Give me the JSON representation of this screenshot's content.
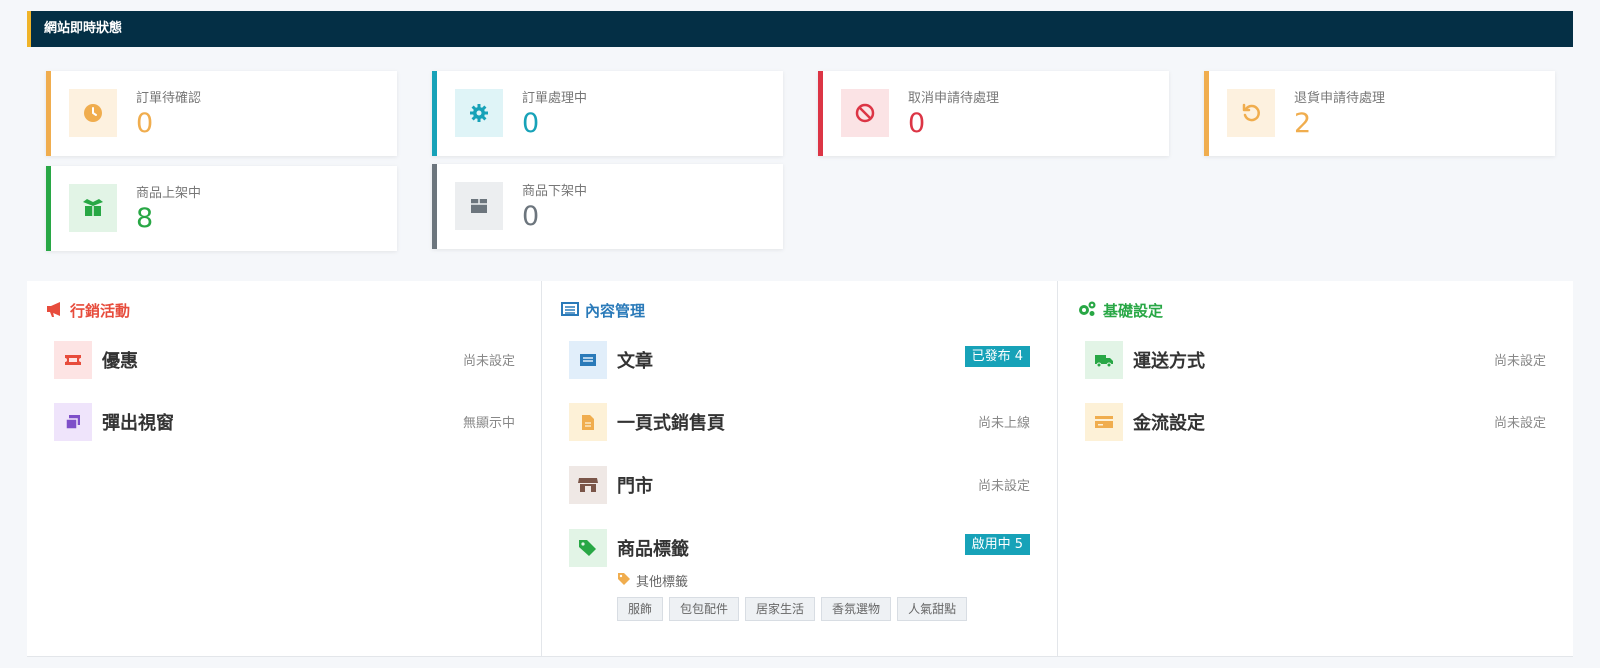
{
  "header": {
    "title": "網站即時狀態"
  },
  "stats": {
    "pending_confirm": {
      "label": "訂單待確認",
      "value": "0",
      "color": "#f0ad4e",
      "icon": "clock-icon"
    },
    "processing": {
      "label": "訂單處理中",
      "value": "0",
      "color": "#17a2b8",
      "icon": "gear-icon"
    },
    "cancel_pending": {
      "label": "取消申請待處理",
      "value": "0",
      "color": "#dc3545",
      "icon": "ban-icon"
    },
    "return_pending": {
      "label": "退貨申請待處理",
      "value": "2",
      "color": "#f0ad4e",
      "icon": "undo-icon"
    },
    "listed": {
      "label": "商品上架中",
      "value": "8",
      "color": "#28a745",
      "icon": "box-open-icon"
    },
    "unlisted": {
      "label": "商品下架中",
      "value": "0",
      "color": "#6c757d",
      "icon": "box-icon"
    }
  },
  "marketing": {
    "title": "行銷活動",
    "color": "#e74c3c",
    "items": [
      {
        "label": "優惠",
        "status": "尚未設定",
        "icon": "ticket-icon"
      },
      {
        "label": "彈出視窗",
        "status": "無顯示中",
        "icon": "window-icon"
      }
    ]
  },
  "content": {
    "title": "內容管理",
    "color": "#2a7ab9",
    "items": [
      {
        "label": "文章",
        "badge": "已發布 4",
        "icon": "newspaper-icon"
      },
      {
        "label": "一頁式銷售頁",
        "status": "尚未上線",
        "icon": "file-icon"
      },
      {
        "label": "門市",
        "status": "尚未設定",
        "icon": "store-icon"
      },
      {
        "label": "商品標籤",
        "badge": "啟用中 5",
        "icon": "tags-icon"
      }
    ],
    "other_tags_title": "其他標籤",
    "tags": [
      "服飾",
      "包包配件",
      "居家生活",
      "香氛選物",
      "人氣甜點"
    ]
  },
  "settings": {
    "title": "基礎設定",
    "color": "#28a745",
    "items": [
      {
        "label": "運送方式",
        "status": "尚未設定",
        "icon": "truck-icon"
      },
      {
        "label": "金流設定",
        "status": "尚未設定",
        "icon": "credit-card-icon"
      }
    ]
  }
}
